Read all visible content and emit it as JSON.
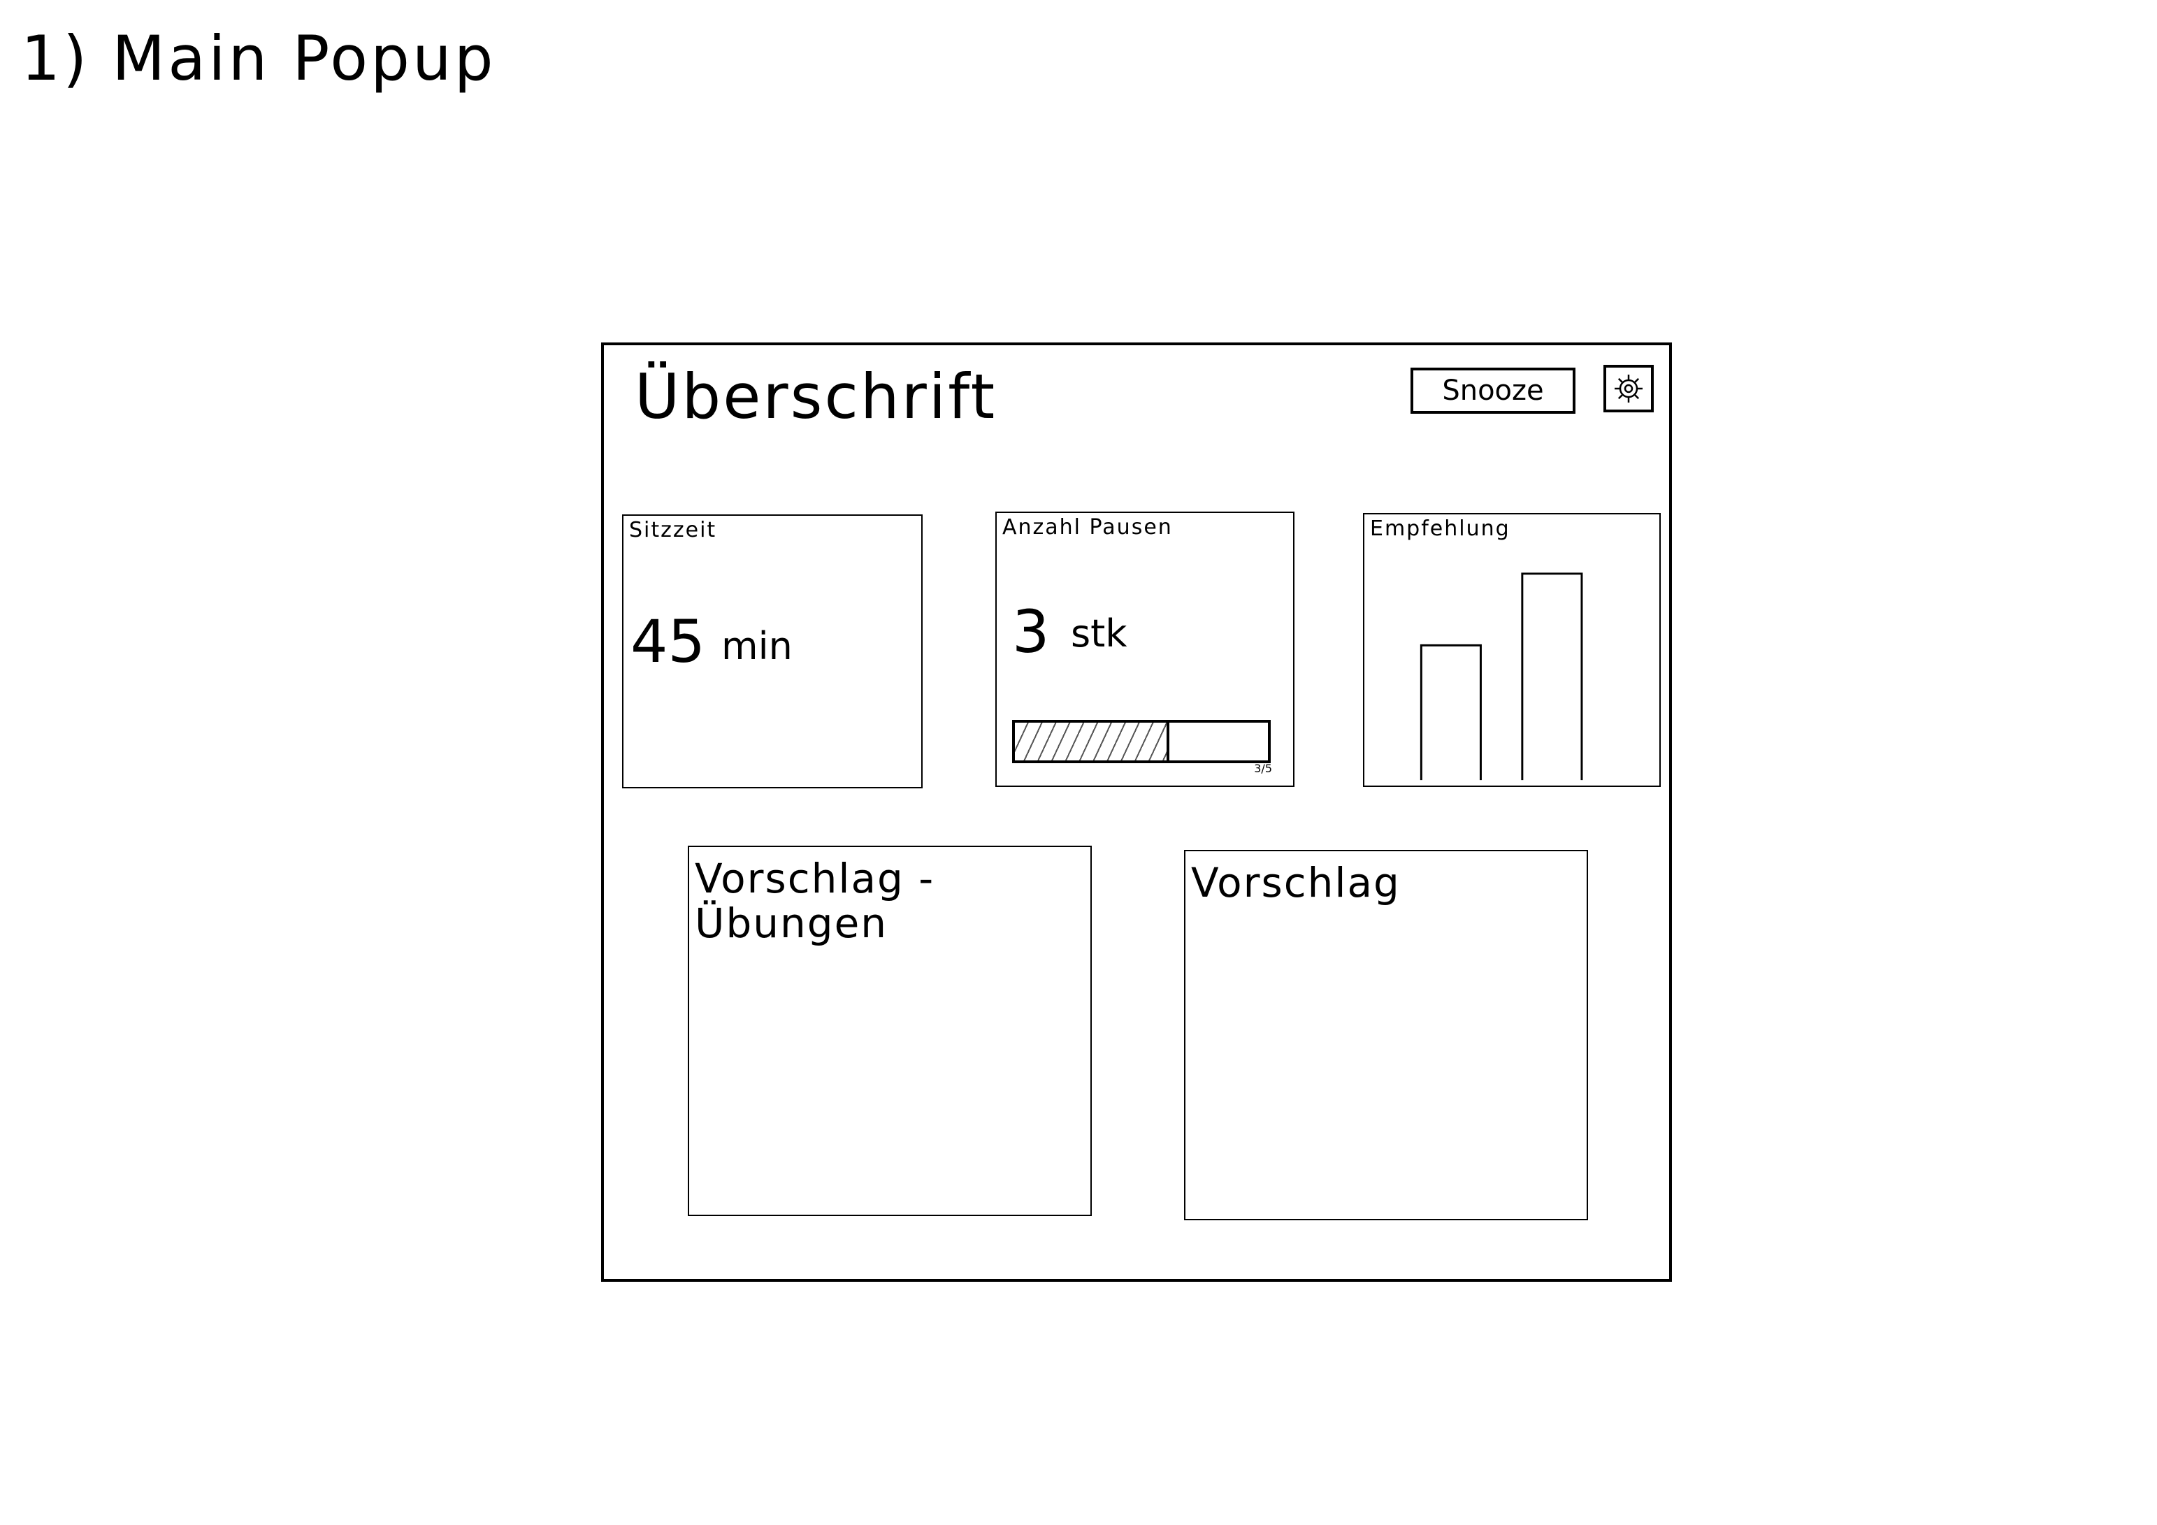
{
  "sketch": {
    "title": "1) Main Popup"
  },
  "popup": {
    "heading": "Überschrift",
    "snooze_label": "Snooze",
    "settings_icon": "gear-icon"
  },
  "cards": {
    "sitzzeit": {
      "label": "Sitzzeit",
      "value": "45",
      "unit": "min"
    },
    "pausen": {
      "label": "Anzahl Pausen",
      "value": "3",
      "unit": "stk",
      "progress_caption": "3/5",
      "progress_fraction": 0.6
    },
    "empfehlung": {
      "label": "Empfehlung"
    },
    "uebungen": {
      "label": "Vorschlag - Übungen"
    },
    "vorschlag": {
      "label": "Vorschlag"
    }
  },
  "chart_data": {
    "type": "bar",
    "categories": [
      "",
      ""
    ],
    "values": [
      0.62,
      0.95
    ],
    "title": "Empfehlung",
    "xlabel": "",
    "ylabel": "",
    "ylim": [
      0,
      1
    ],
    "grid": false
  }
}
